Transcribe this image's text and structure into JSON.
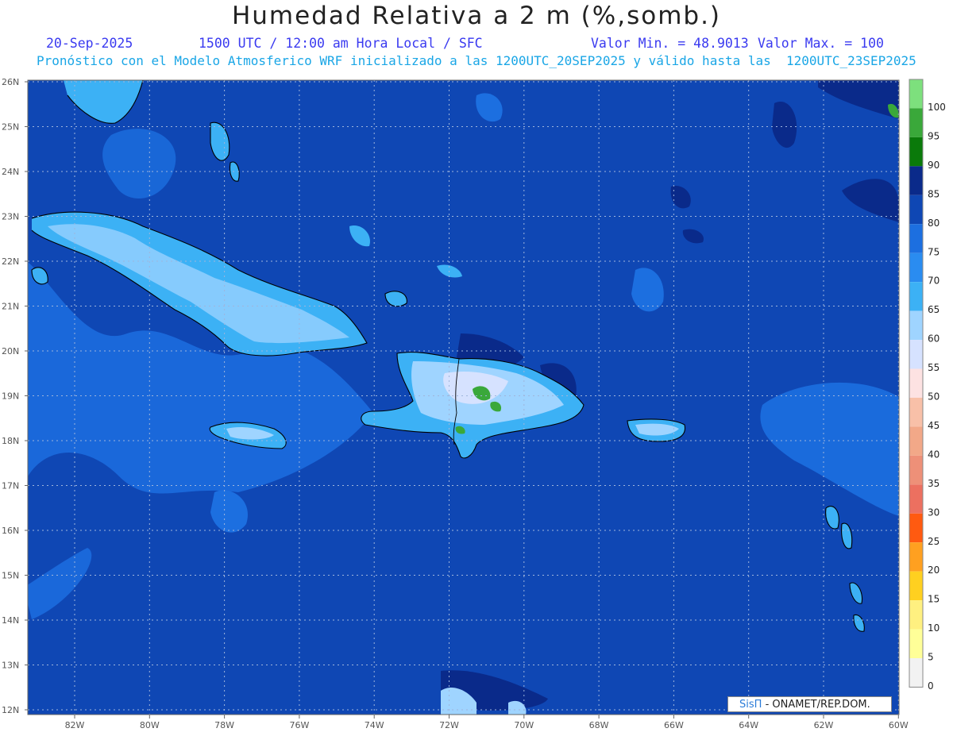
{
  "header": {
    "title": "Humedad Relativa a 2 m (%,somb.)",
    "date": "20-Sep-2025",
    "time_label": "1500 UTC / 12:00 am Hora Local / SFC",
    "min_label": "Valor Min. = 48.9013",
    "max_label": "Valor Max. = 100",
    "forecast_info": "Pronóstico con el Modelo Atmosferico WRF inicializado a las 1200UTC_20SEP2025 y válido hasta las  1200UTC_23SEP2025"
  },
  "map": {
    "lon_labels": [
      "82W",
      "80W",
      "78W",
      "76W",
      "74W",
      "72W",
      "70W",
      "68W",
      "66W",
      "64W",
      "62W",
      "60W"
    ],
    "lat_labels": [
      "26N",
      "25N",
      "24N",
      "23N",
      "22N",
      "21N",
      "20N",
      "19N",
      "18N",
      "17N",
      "16N",
      "15N",
      "14N",
      "13N",
      "12N"
    ],
    "background_color": "#0f47b4"
  },
  "colorbar": {
    "levels": [
      "100",
      "95",
      "90",
      "85",
      "80",
      "75",
      "70",
      "65",
      "60",
      "55",
      "50",
      "45",
      "40",
      "35",
      "30",
      "25",
      "20",
      "15",
      "10",
      "5",
      "0"
    ],
    "colors": [
      "#7de07d",
      "#3aa83a",
      "#0a7a0a",
      "#0a2a8a",
      "#0f47b4",
      "#1c6fe0",
      "#2a8cf0",
      "#3cb1f5",
      "#9fd4ff",
      "#d6e2ff",
      "#fde2e2",
      "#f8c0a8",
      "#f2a888",
      "#ee9078",
      "#ec7060",
      "#ff5a10",
      "#ffa020",
      "#ffd020",
      "#fff080",
      "#ffff98",
      "#f2f2f2"
    ]
  },
  "credit": {
    "logo_text": "SisΠ",
    "text": "- ONAMET/REP.DOM."
  }
}
